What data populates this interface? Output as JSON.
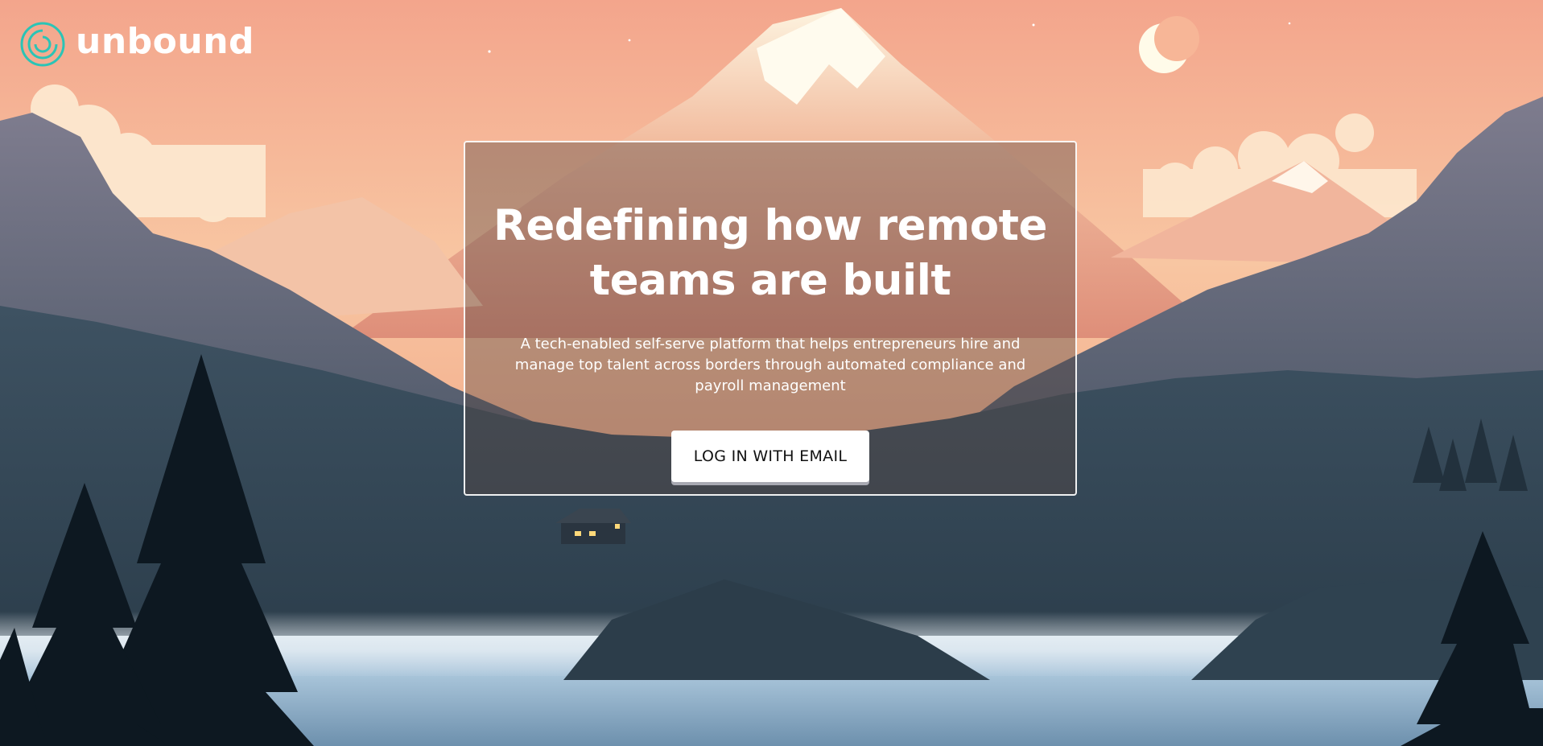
{
  "brand": {
    "name": "unbound",
    "logo_icon": "spiral-logo-icon",
    "logo_color": "#2bc4b6"
  },
  "hero": {
    "title": "Redefining how remote teams are built",
    "subtitle": "A tech-enabled self-serve platform that helps entrepreneurs hire and manage top talent across borders through automated compliance and payroll management",
    "cta_label": "LOG IN WITH EMAIL"
  },
  "background": {
    "scene": "mountain-lake-illustration",
    "sky_color": "#f4a887",
    "forest_color": "#2e4452",
    "lake_color": "#a8c6dc",
    "moon_icon": "crescent-moon-icon"
  }
}
